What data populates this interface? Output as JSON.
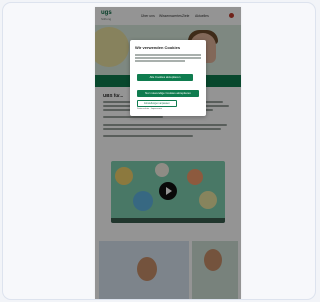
{
  "nav": {
    "logo": "ugs",
    "logo_sub": "Stiftung",
    "links": [
      "Über uns",
      "Wissenswertes",
      "Ziele",
      "Aktuelles"
    ]
  },
  "content": {
    "heading": "UBS für..."
  },
  "cookie_modal": {
    "title": "Wir verwenden Cookies",
    "accept_all_label": "Alle Cookies akzeptieren",
    "accept_necessary_label": "Nur notwendige Cookies akzeptieren",
    "settings_label": "Einstellungen anpassen",
    "links": "Datenschutz · Impressum"
  },
  "colors": {
    "brand_green": "#0f7c4f",
    "hero_green": "#d9eadf",
    "video_teal": "#7fcfb0"
  },
  "icons": {
    "play": "play-icon",
    "flag": "language-flag-icon"
  }
}
